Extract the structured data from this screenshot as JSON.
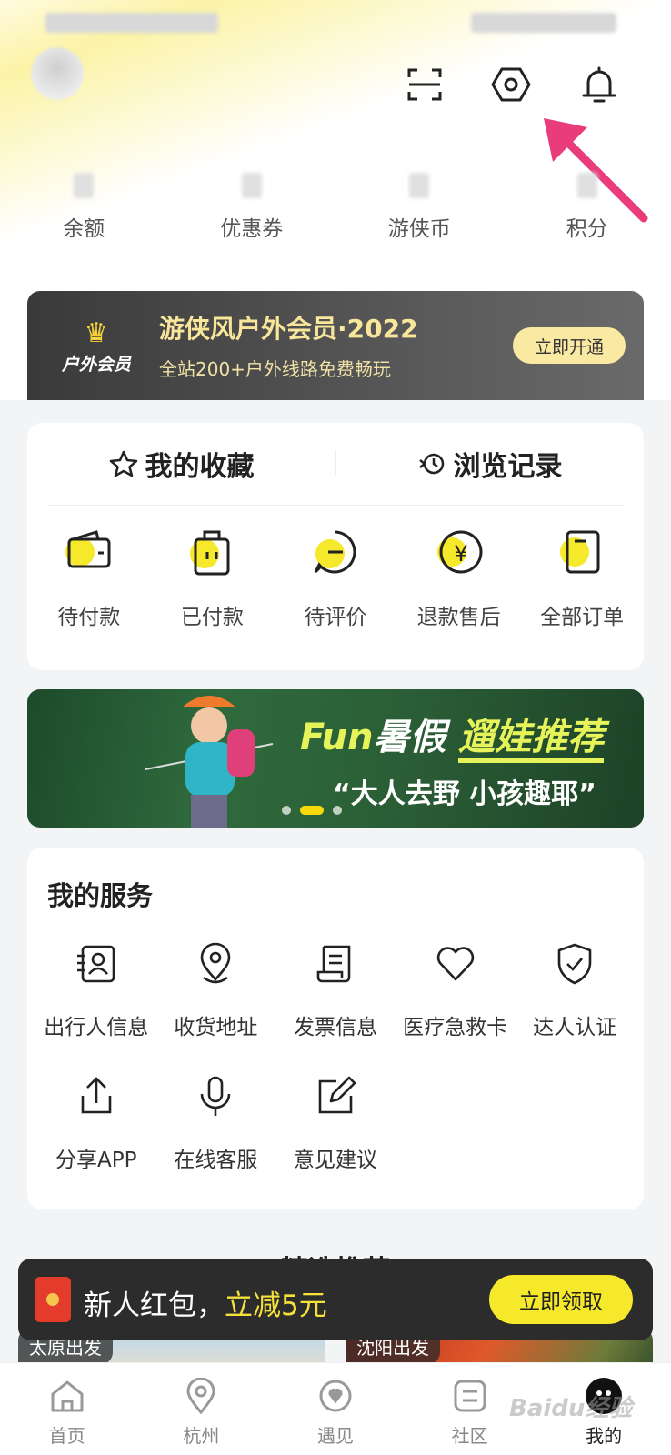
{
  "header": {
    "icons": [
      "scan-icon",
      "settings-icon",
      "bell-icon"
    ]
  },
  "assets": [
    {
      "label": "余额"
    },
    {
      "label": "优惠券"
    },
    {
      "label": "游侠币"
    },
    {
      "label": "积分"
    }
  ],
  "member": {
    "badge": "户外会员",
    "title": "游侠风户外会员·2022",
    "subtitle": "全站200+户外线路免费畅玩",
    "button": "立即开通"
  },
  "orders": {
    "favorites_label": "我的收藏",
    "history_label": "浏览记录",
    "items": [
      {
        "label": "待付款",
        "icon": "wallet-icon"
      },
      {
        "label": "已付款",
        "icon": "bag-icon"
      },
      {
        "label": "待评价",
        "icon": "comment-icon"
      },
      {
        "label": "退款售后",
        "icon": "refund-icon"
      },
      {
        "label": "全部订单",
        "icon": "orders-icon"
      }
    ]
  },
  "banner": {
    "fun": "Fun",
    "headline_a": "暑假 ",
    "headline_b": "遛娃推荐",
    "slogan": "“大人去野 小孩趣耶”"
  },
  "services": {
    "title": "我的服务",
    "row1": [
      {
        "label": "出行人信息",
        "icon": "traveler-icon"
      },
      {
        "label": "收货地址",
        "icon": "location-icon"
      },
      {
        "label": "发票信息",
        "icon": "invoice-icon"
      },
      {
        "label": "医疗急救卡",
        "icon": "heart-icon"
      },
      {
        "label": "达人认证",
        "icon": "shield-check-icon"
      }
    ],
    "row2": [
      {
        "label": "分享APP",
        "icon": "share-icon"
      },
      {
        "label": "在线客服",
        "icon": "microphone-icon"
      },
      {
        "label": "意见建议",
        "icon": "edit-icon"
      }
    ]
  },
  "featured": {
    "title": "精选推荐",
    "cards": [
      {
        "tag": "太原出发"
      },
      {
        "tag": "沈阳出发"
      }
    ]
  },
  "redpacket": {
    "text": "新人红包，",
    "highlight": "立减5元",
    "button": "立即领取"
  },
  "tabbar": [
    {
      "label": "首页",
      "icon": "home-icon"
    },
    {
      "label": "杭州",
      "icon": "map-pin-icon"
    },
    {
      "label": "遇见",
      "icon": "compass-icon"
    },
    {
      "label": "社区",
      "icon": "community-icon"
    },
    {
      "label": "我的",
      "icon": "me-icon",
      "active": true
    }
  ],
  "watermark": "Baidu经验",
  "colors": {
    "accent_yellow": "#f6e82a",
    "member_gold": "#f8e69a",
    "arrow_pink": "#e83d7a"
  }
}
